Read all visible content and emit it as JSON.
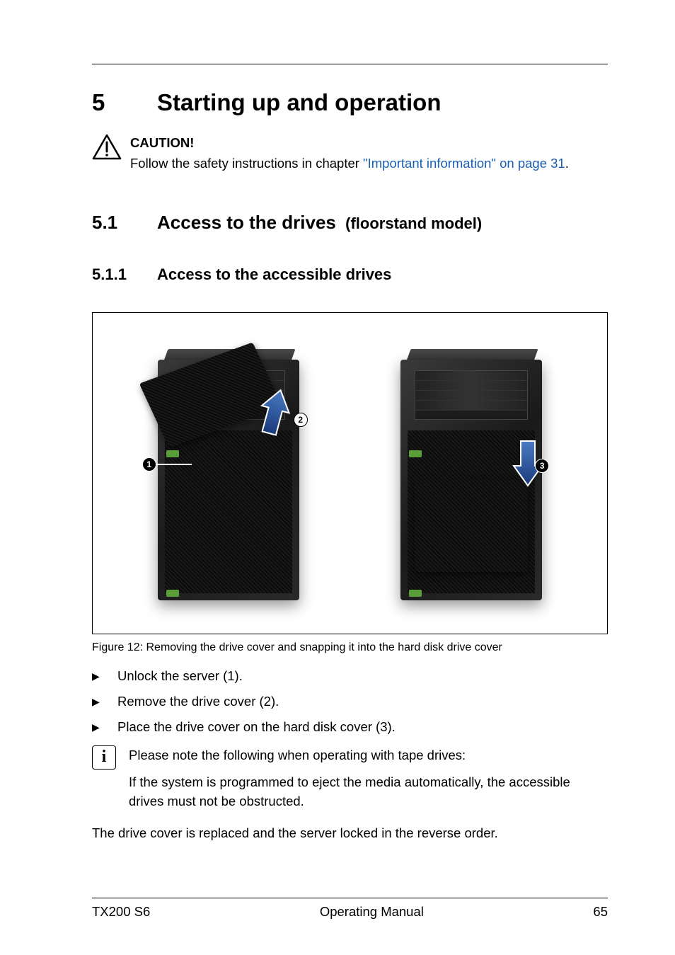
{
  "chapter": {
    "number": "5",
    "title": "Starting up and operation"
  },
  "caution": {
    "label": "CAUTION!",
    "text_prefix": "Follow the safety instructions in chapter ",
    "link_text": "\"Important information\" on page 31",
    "text_suffix": "."
  },
  "section": {
    "number": "5.1",
    "title": "Access to the drives",
    "suffix": "(floorstand model)"
  },
  "subsection": {
    "number": "5.1.1",
    "title": "Access to the accessible drives"
  },
  "figure": {
    "callouts": [
      "1",
      "2",
      "3"
    ],
    "caption": "Figure 12: Removing the drive cover and snapping it into the hard disk drive cover"
  },
  "steps": [
    "Unlock the server (1).",
    "Remove the drive cover (2).",
    "Place the drive cover on the hard disk cover (3)."
  ],
  "info": {
    "icon": "i",
    "line1": "Please note the following when operating with tape drives:",
    "line2": "If the system is programmed to eject the media automatically, the accessible drives must not be obstructed."
  },
  "closing": "The drive cover is replaced and the server locked in the reverse order.",
  "footer": {
    "left": "TX200 S6",
    "center": "Operating Manual",
    "right": "65"
  }
}
